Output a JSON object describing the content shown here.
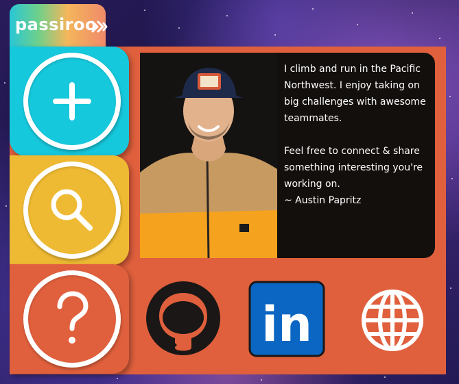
{
  "brand": {
    "name": "passiroo",
    "logo_icon": "sound-wave-icon",
    "gradient": [
      "#28c6d6",
      "#6fd08a",
      "#f4b65b",
      "#f08a6a"
    ]
  },
  "colors": {
    "panel": "#e0603d",
    "add_button": "#16c8dc",
    "search_button": "#efba33",
    "card_background": "#130f0d"
  },
  "actions": [
    {
      "name": "add",
      "icon": "plus-icon"
    },
    {
      "name": "search",
      "icon": "magnifier-icon"
    },
    {
      "name": "help",
      "icon": "question-mark-icon"
    }
  ],
  "profile": {
    "bio_paragraph_1": "I climb and run in the Pacific Northwest. I enjoy taking on big challenges with awesome teammates.",
    "bio_paragraph_2": "Feel free to connect & share something interesting you're working on.",
    "signature": "~ Austin Papritz"
  },
  "social_links": [
    {
      "name": "github",
      "icon": "github-icon"
    },
    {
      "name": "linkedin",
      "icon": "linkedin-icon",
      "label": "in"
    },
    {
      "name": "website",
      "icon": "globe-icon"
    }
  ]
}
